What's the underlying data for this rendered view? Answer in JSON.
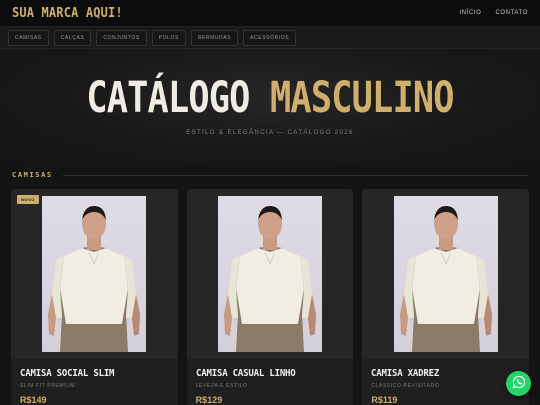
{
  "header": {
    "brand": "SUA MARCA AQUI!",
    "nav": [
      "INÍCIO",
      "CONTATO"
    ]
  },
  "categories": [
    "CAMISAS",
    "CALÇAS",
    "CONJUNTOS",
    "POLOS",
    "BERMUDAS",
    "ACESSÓRIOS"
  ],
  "hero": {
    "title_part1": "CATÁLOGO",
    "title_part2": "MASCULINO",
    "subtitle": "ESTILO & ELEGÂNCIA — CATÁLOGO 2026"
  },
  "section": {
    "title": "CAMISAS"
  },
  "products": [
    {
      "badge": "NOVO",
      "name": "CAMISA SOCIAL SLIM",
      "subtitle": "SLIM FIT PREMIUM",
      "price": "R$149"
    },
    {
      "badge": "",
      "name": "CAMISA CASUAL LINHO",
      "subtitle": "LEVEZA E ESTILO",
      "price": "R$129"
    },
    {
      "badge": "",
      "name": "CAMISA XADREZ",
      "subtitle": "CLÁSSICO REVISITADO",
      "price": "R$119"
    }
  ],
  "icons": {
    "floating": "whatsapp-icon"
  },
  "colors": {
    "accent": "#cfae6e",
    "background": "#141414",
    "whatsapp": "#25d366"
  }
}
